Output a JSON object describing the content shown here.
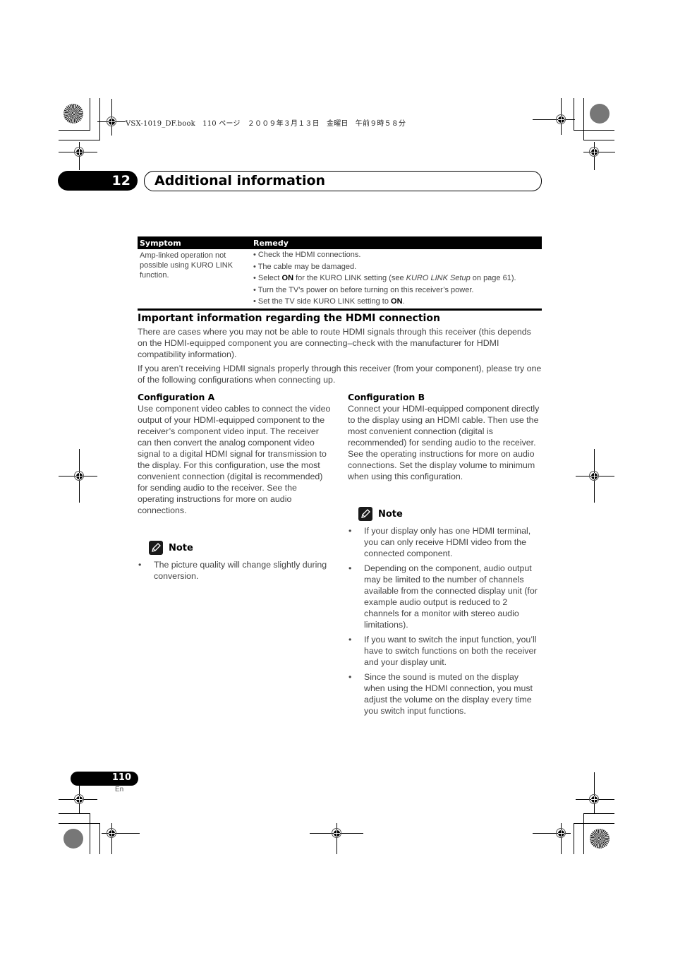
{
  "print_header": {
    "file_info": "VSX-1019_DF.book　110 ページ　２００９年３月１３日　金曜日　午前９時５８分"
  },
  "chapter": {
    "number": "12",
    "title": "Additional information"
  },
  "troubleshooting_table": {
    "headers": [
      "Symptom",
      "Remedy"
    ],
    "rows": [
      {
        "symptom": "Amp-linked operation not possible using KURO LINK function.",
        "remedies": [
          {
            "parts": [
              {
                "text": "• Check the HDMI connections.",
                "style": "normal"
              }
            ]
          },
          {
            "parts": [
              {
                "text": "• The cable may be damaged.",
                "style": "normal"
              }
            ]
          },
          {
            "parts": [
              {
                "text": "• Select ",
                "style": "normal"
              },
              {
                "text": "ON",
                "style": "bold"
              },
              {
                "text": " for the KURO LINK setting (see ",
                "style": "normal"
              },
              {
                "text": "KURO LINK Setup",
                "style": "italic"
              },
              {
                "text": " on page 61).",
                "style": "normal"
              }
            ]
          },
          {
            "parts": [
              {
                "text": "• Turn the TV’s power on before turning on this receiver’s power.",
                "style": "normal"
              }
            ]
          },
          {
            "parts": [
              {
                "text": "• Set the TV side KURO LINK setting to ",
                "style": "normal"
              },
              {
                "text": "ON",
                "style": "bold"
              },
              {
                "text": ".",
                "style": "normal"
              }
            ]
          }
        ]
      }
    ]
  },
  "hdmi_section": {
    "title": "Important information regarding the HDMI connection",
    "paragraphs": [
      "There are cases where you may not be able to route HDMI signals through this receiver (this depends on the HDMI-equipped component you are connecting–check with the manufacturer for HDMI compatibility information).",
      "If you aren’t receiving HDMI signals properly through this receiver (from your component), please try one of the following configurations when connecting up."
    ],
    "config_a": {
      "title": "Configuration A",
      "body": "Use component video cables to connect the video output of your HDMI-equipped component to the receiver’s component video input. The receiver can then convert the analog component video signal to a digital HDMI signal for transmission to the display. For this configuration, use the most convenient connection (digital is recommended) for sending audio to the receiver. See the operating instructions for more on audio connections.",
      "note_label": "Note",
      "notes": [
        "The picture quality will change slightly during conversion."
      ]
    },
    "config_b": {
      "title": "Configuration B",
      "body": "Connect your HDMI-equipped component directly to the display using an HDMI cable. Then use the most convenient connection (digital is recommended) for sending audio to the receiver. See the operating instructions for more on audio connections. Set the display volume to minimum when using this configuration.",
      "note_label": "Note",
      "notes": [
        "If your display only has one HDMI terminal, you can only receive HDMI video from the connected component.",
        "Depending on the component, audio output may be limited to the number of channels available from the connected display unit (for example audio output is reduced to 2 channels for a monitor with stereo audio limitations).",
        "If you want to switch the input function, you’ll have to switch functions on both the receiver and your display unit.",
        "Since the sound is muted on the display when using the HDMI connection, you must adjust the volume on the display every time you switch input functions."
      ]
    }
  },
  "footer": {
    "page_number": "110",
    "language": "En"
  }
}
